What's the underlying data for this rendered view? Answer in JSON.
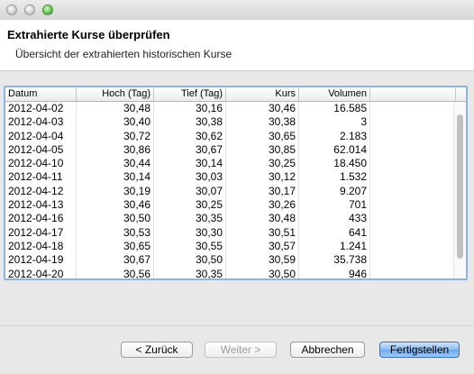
{
  "header": {
    "title": "Extrahierte Kurse überprüfen",
    "subtitle": "Übersicht der extrahierten historischen Kurse"
  },
  "table": {
    "columns": [
      "Datum",
      "Hoch (Tag)",
      "Tief (Tag)",
      "Kurs",
      "Volumen"
    ],
    "rows": [
      [
        "2012-04-02",
        "30,48",
        "30,16",
        "30,46",
        "16.585"
      ],
      [
        "2012-04-03",
        "30,40",
        "30,38",
        "30,38",
        "3"
      ],
      [
        "2012-04-04",
        "30,72",
        "30,62",
        "30,65",
        "2.183"
      ],
      [
        "2012-04-05",
        "30,86",
        "30,67",
        "30,85",
        "62.014"
      ],
      [
        "2012-04-10",
        "30,44",
        "30,14",
        "30,25",
        "18.450"
      ],
      [
        "2012-04-11",
        "30,14",
        "30,03",
        "30,12",
        "1.532"
      ],
      [
        "2012-04-12",
        "30,19",
        "30,07",
        "30,17",
        "9.207"
      ],
      [
        "2012-04-13",
        "30,46",
        "30,25",
        "30,26",
        "701"
      ],
      [
        "2012-04-16",
        "30,50",
        "30,35",
        "30,48",
        "433"
      ],
      [
        "2012-04-17",
        "30,53",
        "30,30",
        "30,51",
        "641"
      ],
      [
        "2012-04-18",
        "30,65",
        "30,55",
        "30,57",
        "1.241"
      ],
      [
        "2012-04-19",
        "30,67",
        "30,50",
        "30,59",
        "35.738"
      ],
      [
        "2012-04-20",
        "30,56",
        "30,35",
        "30,50",
        "946"
      ]
    ]
  },
  "buttons": {
    "back": "< Zurück",
    "next": "Weiter >",
    "cancel": "Abbrechen",
    "finish": "Fertigstellen"
  },
  "colors": {
    "selection_border": "#8db2e3",
    "primary_button": "#6ea8ec"
  }
}
